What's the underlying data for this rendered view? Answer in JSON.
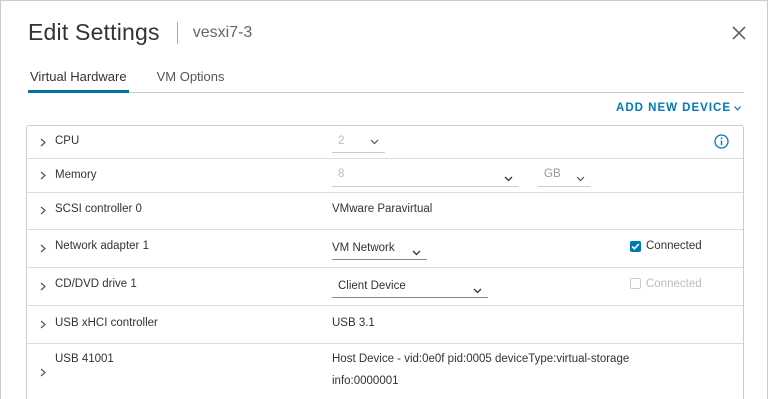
{
  "dialog": {
    "title": "Edit Settings",
    "subtitle": "vesxi7-3"
  },
  "tabs": [
    {
      "label": "Virtual Hardware",
      "active": true
    },
    {
      "label": "VM Options",
      "active": false
    }
  ],
  "add_device_label": "ADD NEW DEVICE",
  "devices": {
    "cpu": {
      "name": "CPU",
      "value": "2"
    },
    "memory": {
      "name": "Memory",
      "value": "8",
      "unit": "GB"
    },
    "scsi": {
      "name": "SCSI controller 0",
      "value": "VMware Paravirtual"
    },
    "network": {
      "name": "Network adapter 1",
      "value": "VM Network",
      "connected_label": "Connected",
      "connected": true
    },
    "cdrom": {
      "name": "CD/DVD drive 1",
      "value": "Client Device",
      "connected_label": "Connected",
      "connected": false
    },
    "usb_ctrl": {
      "name": "USB xHCI controller",
      "value": "USB 3.1"
    },
    "usb_dev": {
      "name": "USB 41001",
      "value_line1": "Host Device - vid:0e0f pid:0005 deviceType:virtual-storage",
      "value_line2": "info:0000001"
    }
  },
  "colors": {
    "accent": "#0079b8",
    "tab_underline": "#0072a3"
  }
}
